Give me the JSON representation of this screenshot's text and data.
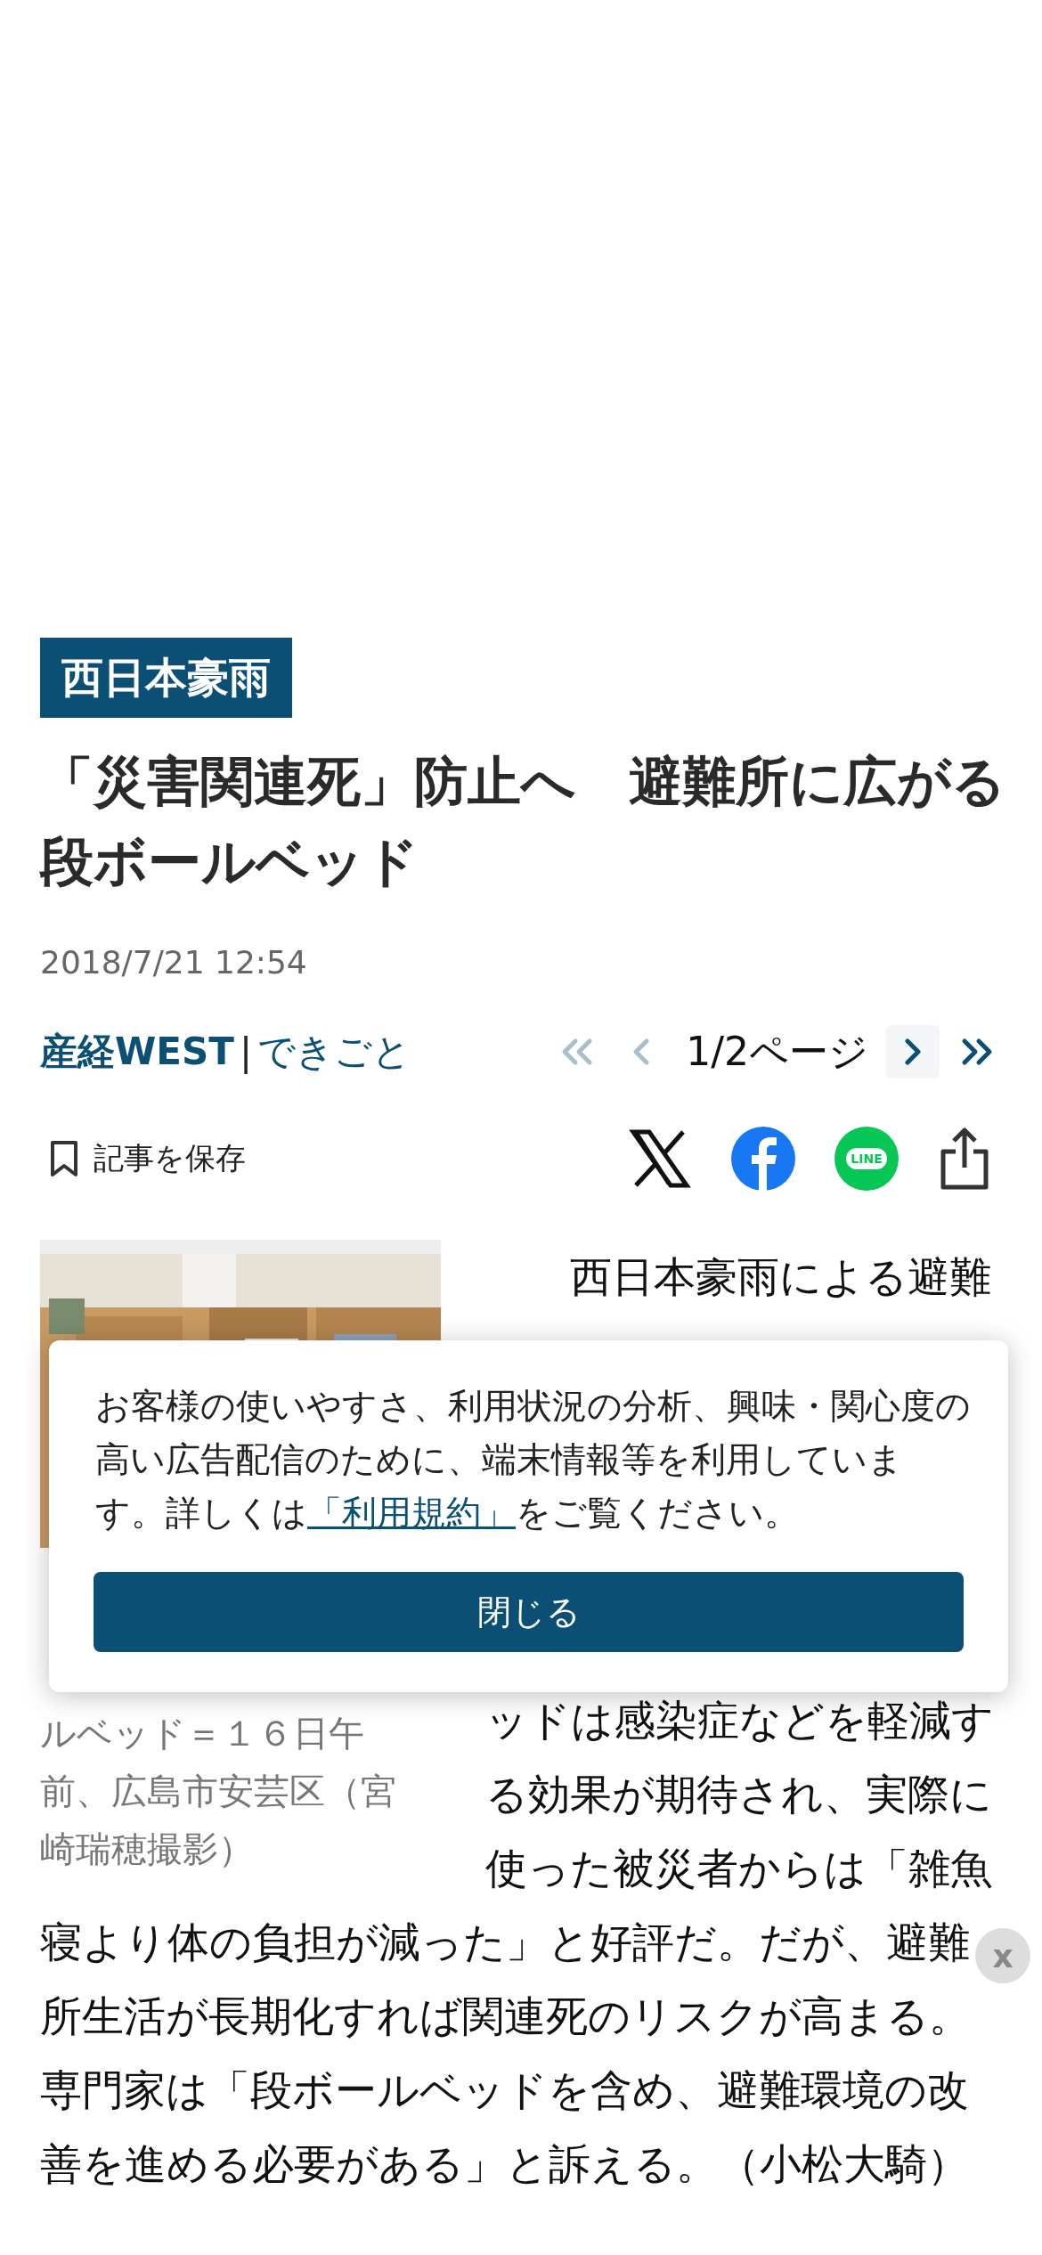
{
  "category_tag": "西日本豪雨",
  "headline": [
    "「災害関連死」防止へ　避難所に広がる",
    "段ボールベッド"
  ],
  "published": "2018/7/21 12:54",
  "source": {
    "name": "産経WEST",
    "separator": "|",
    "section": "できごと"
  },
  "pager": {
    "label": "1/2ページ",
    "buttons": [
      {
        "kind": "first",
        "disabled": true
      },
      {
        "kind": "prev",
        "disabled": true
      },
      {
        "kind": "next",
        "disabled": false
      },
      {
        "kind": "last",
        "disabled": false
      }
    ]
  },
  "save": {
    "label": "記事を保存"
  },
  "share": [
    {
      "kind": "x"
    },
    {
      "kind": "facebook"
    },
    {
      "kind": "line",
      "label": "LINE"
    },
    {
      "kind": "share"
    }
  ],
  "article": {
    "photo": {
      "kind": "picture"
    },
    "caption_lines": [
      "ルベッド＝１６日午",
      "前、広島市安芸区（宮",
      "崎瑞穂撮影）"
    ],
    "side_lines_top": [
      "西日本豪雨による避難"
    ],
    "side_lines_bottom": [
      "ッドは感染症などを軽減す",
      "る効果が期待され、実際に",
      "使った被災者からは「雑魚"
    ],
    "full_lines": [
      "寝より体の負担が減った」と好評だ。だが、避難",
      "所生活が長期化すれば関連死のリスクが高まる。",
      "専門家は「段ボールベッドを含め、避難環境の改",
      "善を進める必要がある」と訴える。（小松大騎）"
    ]
  },
  "consent": {
    "text_before": "お客様の使いやすさ、利用状況の分析、興味・関心度の高い広告配信のために、端末情報等を利用しています。詳しくは",
    "link": "「利用規約」",
    "text_after": "をご覧ください。",
    "button": "閉じる"
  },
  "ad_close": "x"
}
